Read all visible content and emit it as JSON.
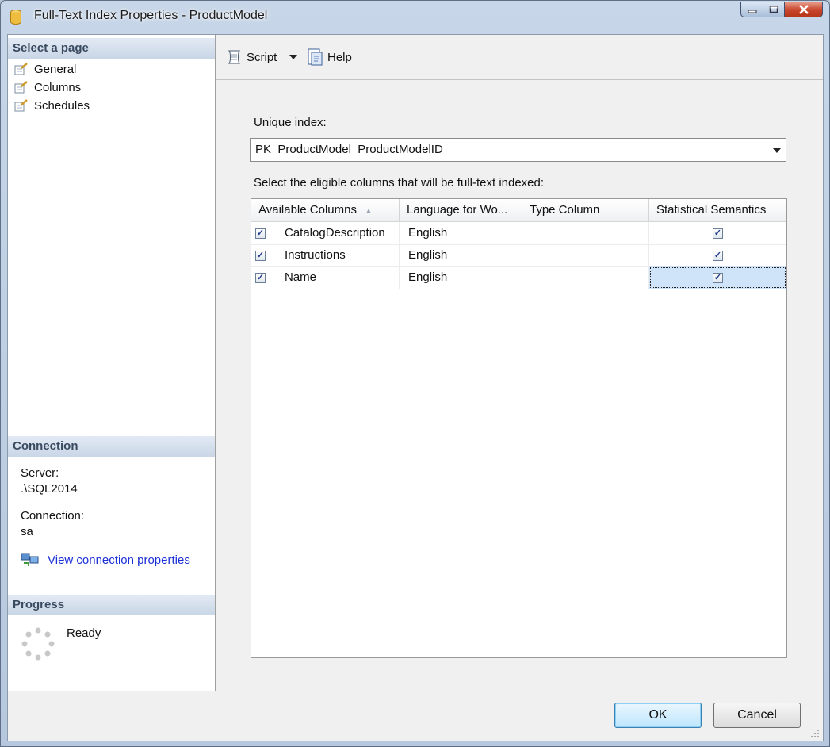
{
  "window": {
    "title": "Full-Text Index Properties - ProductModel",
    "controls": {
      "minimize_icon": "minimize-icon",
      "maximize_icon": "maximize-icon",
      "close_icon": "close-icon"
    }
  },
  "left_pane": {
    "select_page_header": "Select a page",
    "pages": [
      {
        "label": "General",
        "icon": "page-properties-icon"
      },
      {
        "label": "Columns",
        "icon": "page-properties-icon"
      },
      {
        "label": "Schedules",
        "icon": "page-properties-icon"
      }
    ],
    "connection": {
      "header": "Connection",
      "server_label": "Server:",
      "server_value": ".\\SQL2014",
      "connection_label": "Connection:",
      "connection_value": "sa",
      "link_text": "View connection properties",
      "link_icon": "connection-properties-icon"
    },
    "progress": {
      "header": "Progress",
      "status": "Ready",
      "icon": "progress-spinner-icon"
    }
  },
  "toolbar": {
    "script_label": "Script",
    "script_icon": "script-icon",
    "dropdown_icon": "dropdown-arrow-icon",
    "help_label": "Help",
    "help_icon": "help-icon"
  },
  "form": {
    "unique_index_label": "Unique index:",
    "unique_index_value": "PK_ProductModel_ProductModelID",
    "columns_label": "Select the eligible columns that will be full-text indexed:"
  },
  "grid": {
    "headers": [
      "Available Columns",
      "Language for Wo...",
      "Type Column",
      "Statistical Semantics"
    ],
    "rows": [
      {
        "selected": true,
        "column": "CatalogDescription",
        "language": "English",
        "type_column": "",
        "statistical_semantics": true
      },
      {
        "selected": true,
        "column": "Instructions",
        "language": "English",
        "type_column": "",
        "statistical_semantics": true
      },
      {
        "selected": true,
        "column": "Name",
        "language": "English",
        "type_column": "",
        "statistical_semantics": true
      }
    ]
  },
  "buttons": {
    "ok": "OK",
    "cancel": "Cancel"
  }
}
